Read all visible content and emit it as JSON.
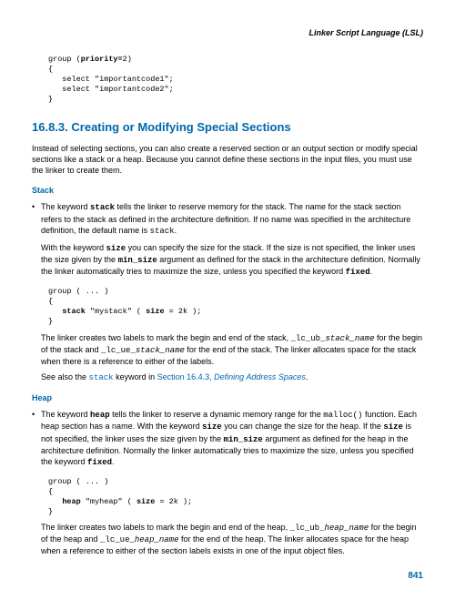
{
  "header": {
    "title": "Linker Script Language (LSL)"
  },
  "code_top": "group (priority=2)\n{\n   select \"importantcode1\";\n   select \"importantcode2\";\n}",
  "section": {
    "number": "16.8.3.",
    "title": "Creating or Modifying Special Sections"
  },
  "intro": "Instead of selecting sections, you can also create a reserved section or an output section or modify special sections like a stack or a heap. Because you cannot define these sections in the input files, you must use the linker to create them.",
  "stack": {
    "heading": "Stack",
    "p1_a": "The keyword ",
    "p1_kw1": "stack",
    "p1_b": " tells the linker to reserve memory for the stack. The name for the stack section refers to the stack as defined in the architecture definition. If no name was specified in the architecture definition, the default name is ",
    "p1_kw2": "stack",
    "p1_c": ".",
    "p2_a": "With the keyword ",
    "p2_kw1": "size",
    "p2_b": " you can specify the size for the stack. If the size is not specified, the linker uses the size given by the ",
    "p2_kw2": "min_size",
    "p2_c": " argument as defined for the stack in the architecture definition. Normally the linker automatically tries to maximize the size, unless you specified the keyword ",
    "p2_kw3": "fixed",
    "p2_d": ".",
    "code": "group ( ... )\n{\n   stack \"mystack\" ( size = 2k );\n}",
    "p3_a": "The linker creates two labels to mark the begin and end of the stack, ",
    "p3_kw1": "_lc_ub_",
    "p3_it1": "stack_name",
    "p3_b": " for the begin of the stack and ",
    "p3_kw2": "_lc_ue_",
    "p3_it2": "stack_name",
    "p3_c": " for the end of the stack. The linker allocates space for the stack when there is a reference to either of the labels.",
    "p4_a": "See also the ",
    "p4_kw1": "stack",
    "p4_b": " keyword in ",
    "p4_link": "Section 16.4.3, ",
    "p4_link_it": "Defining Address Spaces",
    "p4_c": "."
  },
  "heap": {
    "heading": "Heap",
    "p1_a": "The keyword ",
    "p1_kw1": "heap",
    "p1_b": " tells the linker to reserve a dynamic memory range for the ",
    "p1_kw2": "malloc()",
    "p1_c": " function. Each heap section has a name. With the keyword ",
    "p1_kw3": "size",
    "p1_d": " you can change the size for the heap. If the ",
    "p1_kw4": "size",
    "p1_e": " is not specified, the linker uses the size given by the ",
    "p1_kw5": "min_size",
    "p1_f": " argument as defined for the heap in the architecture definition. Normally the linker automatically tries to maximize the size, unless you specified the keyword ",
    "p1_kw6": "fixed",
    "p1_g": ".",
    "code": "group ( ... )\n{\n   heap \"myheap\" ( size = 2k );\n}",
    "p2_a": "The linker creates two labels to mark the begin and end of the heap, ",
    "p2_kw1": "_lc_ub_",
    "p2_it1": "heap_name",
    "p2_b": " for the begin of the heap and ",
    "p2_kw2": "_lc_ue_",
    "p2_it2": "heap_name",
    "p2_c": " for the end of the heap. The linker allocates space for the heap when a reference to either of the section labels exists in one of the input object files."
  },
  "page_number": "841"
}
